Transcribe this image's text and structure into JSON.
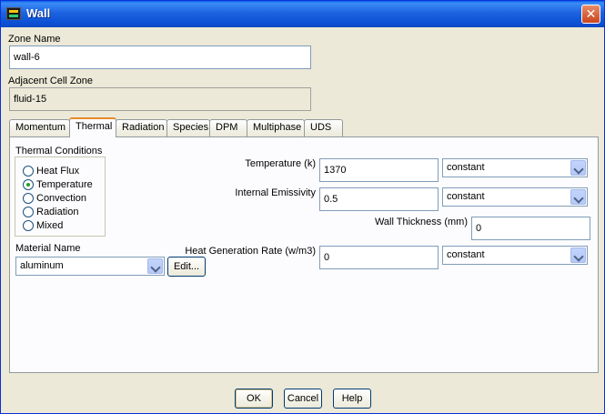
{
  "window": {
    "title": "Wall",
    "close_symbol": "✕"
  },
  "zone_name": {
    "label": "Zone Name",
    "value": "wall-6"
  },
  "adjacent_cell_zone": {
    "label": "Adjacent Cell Zone",
    "value": "fluid-15"
  },
  "tabs": [
    {
      "label": "Momentum"
    },
    {
      "label": "Thermal",
      "active": true
    },
    {
      "label": "Radiation"
    },
    {
      "label": "Species"
    },
    {
      "label": "DPM"
    },
    {
      "label": "Multiphase"
    },
    {
      "label": "UDS"
    }
  ],
  "thermal": {
    "conditions_label": "Thermal Conditions",
    "options": [
      "Heat Flux",
      "Temperature",
      "Convection",
      "Radiation",
      "Mixed"
    ],
    "selected": "Temperature",
    "material_label": "Material Name",
    "material_value": "aluminum",
    "edit_label": "Edit...",
    "temperature_label": "Temperature (k)",
    "temperature_value": "1370",
    "temperature_method": "constant",
    "emissivity_label": "Internal Emissivity",
    "emissivity_value": "0.5",
    "emissivity_method": "constant",
    "wall_thickness_label": "Wall Thickness (mm)",
    "wall_thickness_value": "0",
    "heat_gen_label": "Heat Generation Rate (w/m3)",
    "heat_gen_value": "0",
    "heat_gen_method": "constant"
  },
  "buttons": {
    "ok": "OK",
    "cancel": "Cancel",
    "help": "Help"
  }
}
